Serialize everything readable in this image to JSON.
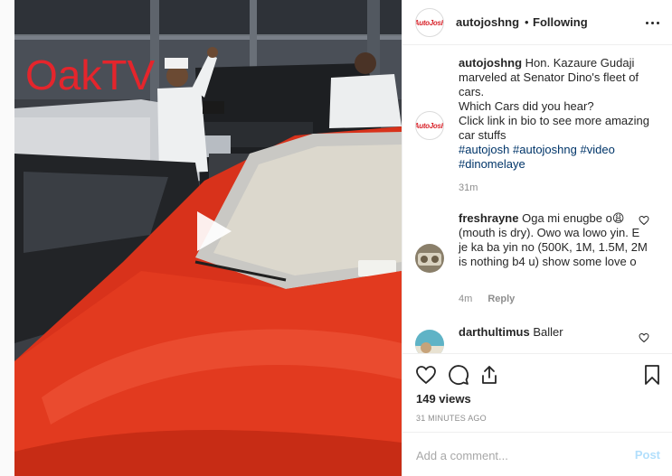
{
  "post": {
    "username": "autojoshng",
    "separator": "•",
    "follow_status": "Following",
    "avatar_text": "AutoJosh",
    "video_watermark": "OakTV"
  },
  "caption": {
    "username": "autojoshng",
    "text_1": "Hon. Kazaure Gudaji marveled at Senator Dino's fleet of cars.",
    "text_2": "Which Cars did you hear?",
    "text_3": "Click link in bio to see more amazing car stuffs",
    "hashtags": [
      "#autojosh",
      "#autojoshng",
      "#video",
      "#dinomelaye"
    ],
    "time": "31m"
  },
  "comments": [
    {
      "username": "freshrayne",
      "text": "Oga mi enugbe o😩 (mouth is dry). Owo wa lowo yin. E je ka ba yin no (500K, 1M, 1.5M, 2M is nothing b4 u) show some love o",
      "time": "4m",
      "reply_label": "Reply"
    },
    {
      "username": "darthultimus",
      "text": "Baller"
    }
  ],
  "actions": {
    "icons": [
      "heart-icon",
      "comment-icon",
      "share-icon",
      "bookmark-icon"
    ],
    "views": "149 views",
    "time_ago": "31 MINUTES AGO",
    "comment_placeholder": "Add a comment...",
    "post_label": "Post"
  },
  "colors": {
    "watermark": "#e4252c",
    "hashtag": "#003569",
    "post_disabled": "#b2dffc",
    "muted": "#8e8e8e",
    "car_red": "#e23a1f"
  }
}
